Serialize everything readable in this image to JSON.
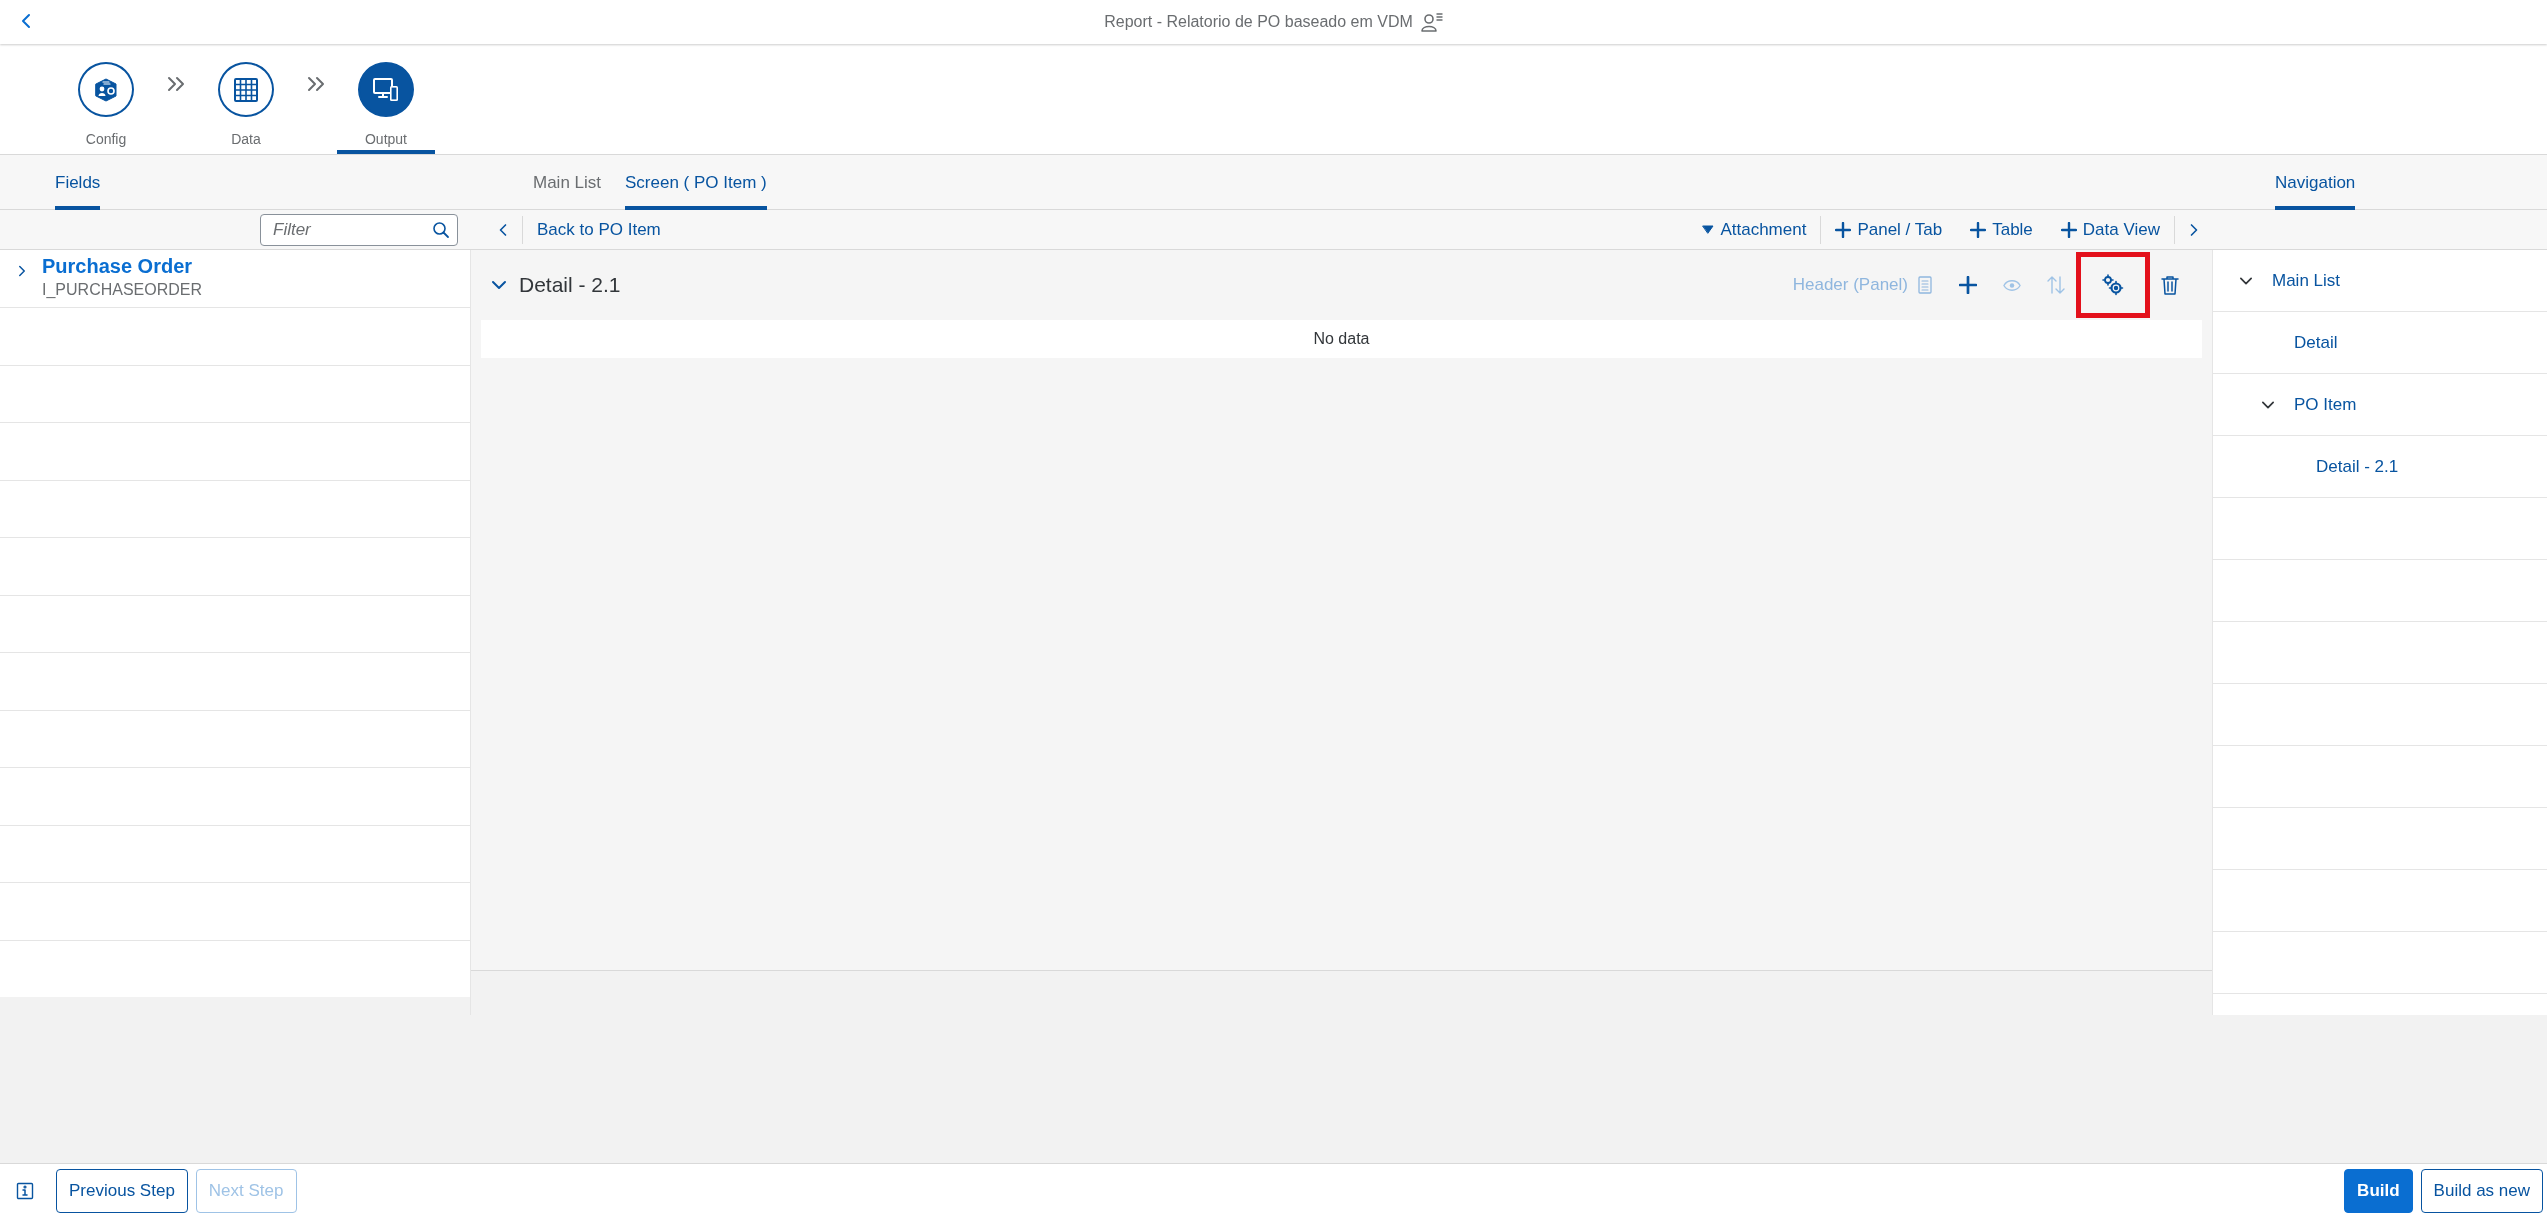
{
  "header": {
    "title": "Report - Relatorio de PO baseado em VDM"
  },
  "steps": [
    {
      "label": "Config",
      "kind": "config",
      "selected": false
    },
    {
      "label": "Data",
      "kind": "data",
      "selected": false
    },
    {
      "label": "Output",
      "kind": "output",
      "selected": true
    }
  ],
  "fields_panel": {
    "tab": {
      "label": "Fields",
      "selected": true
    },
    "filter_placeholder": "Filter",
    "items": [
      {
        "title": "Purchase Order",
        "subtitle": "I_PURCHASEORDER",
        "expanded": false
      }
    ]
  },
  "screen_tabs": [
    {
      "label": "Main List",
      "selected": false
    },
    {
      "label": "Screen ( PO Item )",
      "selected": true
    }
  ],
  "toolbar": {
    "back_label": "Back to PO Item",
    "actions": [
      {
        "label": "Attachment",
        "kind": "dropdown"
      },
      {
        "label": "Panel / Tab",
        "kind": "add"
      },
      {
        "label": "Table",
        "kind": "add"
      },
      {
        "label": "Data View",
        "kind": "add"
      }
    ]
  },
  "section": {
    "title": "Detail - 2.1",
    "expanded": true,
    "header_label": "Header (Panel)",
    "tools": [
      {
        "kind": "add",
        "disabled": false,
        "highlighted": false
      },
      {
        "kind": "view",
        "disabled": true,
        "highlighted": false
      },
      {
        "kind": "sort",
        "disabled": true,
        "highlighted": false
      },
      {
        "kind": "settings",
        "disabled": false,
        "highlighted": true
      },
      {
        "kind": "delete",
        "disabled": false,
        "highlighted": false
      }
    ],
    "empty_text": "No data"
  },
  "navigation": {
    "tab": {
      "label": "Navigation",
      "selected": true
    },
    "items": [
      {
        "label": "Main List",
        "expanded": true,
        "children": [
          {
            "label": "Detail"
          },
          {
            "label": "PO Item",
            "expanded": true,
            "children": [
              {
                "label": "Detail - 2.1"
              }
            ]
          }
        ]
      }
    ]
  },
  "footer": {
    "buttons": [
      {
        "label": "Previous Step",
        "disabled": false
      },
      {
        "label": "Next Step",
        "disabled": true
      }
    ],
    "actions": [
      {
        "label": "Build",
        "kind": "primary"
      },
      {
        "label": "Build as new",
        "kind": "outline"
      }
    ]
  }
}
